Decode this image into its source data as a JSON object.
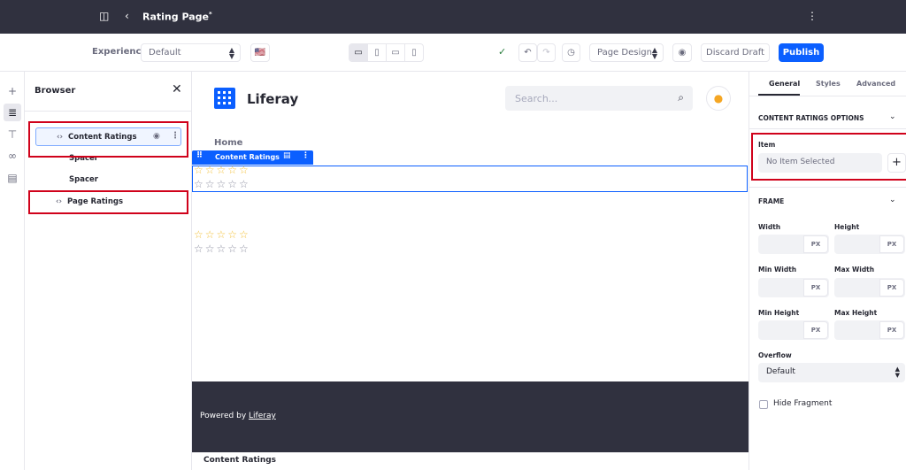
{
  "topbar": {
    "title": "Rating Page",
    "dirty_marker": "*",
    "icons": {
      "sidebar": "sidebar-toggle-icon",
      "back": "chevron-left-icon",
      "more": "vertical-ellipsis-icon"
    }
  },
  "toolbar": {
    "experience_label": "Experience",
    "experience_value": "Default",
    "language_flag": "🇺🇸",
    "devices": [
      "desktop",
      "tablet",
      "landscape",
      "phone"
    ],
    "page_design_label": "Page Design",
    "discard_label": "Discard Draft",
    "publish_label": "Publish",
    "status_icon": "check-circle-icon"
  },
  "browser": {
    "title": "Browser",
    "items": [
      {
        "label": "Content Ratings",
        "type": "fragment"
      },
      {
        "label": "Spacer",
        "type": "plain"
      },
      {
        "label": "Spacer",
        "type": "plain"
      },
      {
        "label": "Page Ratings",
        "type": "fragment"
      }
    ]
  },
  "page": {
    "site_name": "Liferay",
    "search_placeholder": "Search...",
    "nav_home": "Home",
    "fragment_label": "Content Ratings",
    "footer_text": "Powered by ",
    "footer_link": "Liferay",
    "bottom_label": "Content Ratings"
  },
  "panel": {
    "tabs": [
      "General",
      "Styles",
      "Advanced"
    ],
    "active_tab": "General",
    "section_options": "CONTENT RATINGS OPTIONS",
    "item_label": "Item",
    "item_placeholder": "No Item Selected",
    "section_frame": "FRAME",
    "width_label": "Width",
    "height_label": "Height",
    "min_width_label": "Min Width",
    "max_width_label": "Max Width",
    "min_height_label": "Min Height",
    "max_height_label": "Max Height",
    "unit": "PX",
    "overflow_label": "Overflow",
    "overflow_value": "Default",
    "hide_fragment_label": "Hide Fragment"
  },
  "colors": {
    "accent": "#0b5fff",
    "topbar": "#30313f",
    "highlight": "#d0021b",
    "star": "#f3c13a"
  }
}
